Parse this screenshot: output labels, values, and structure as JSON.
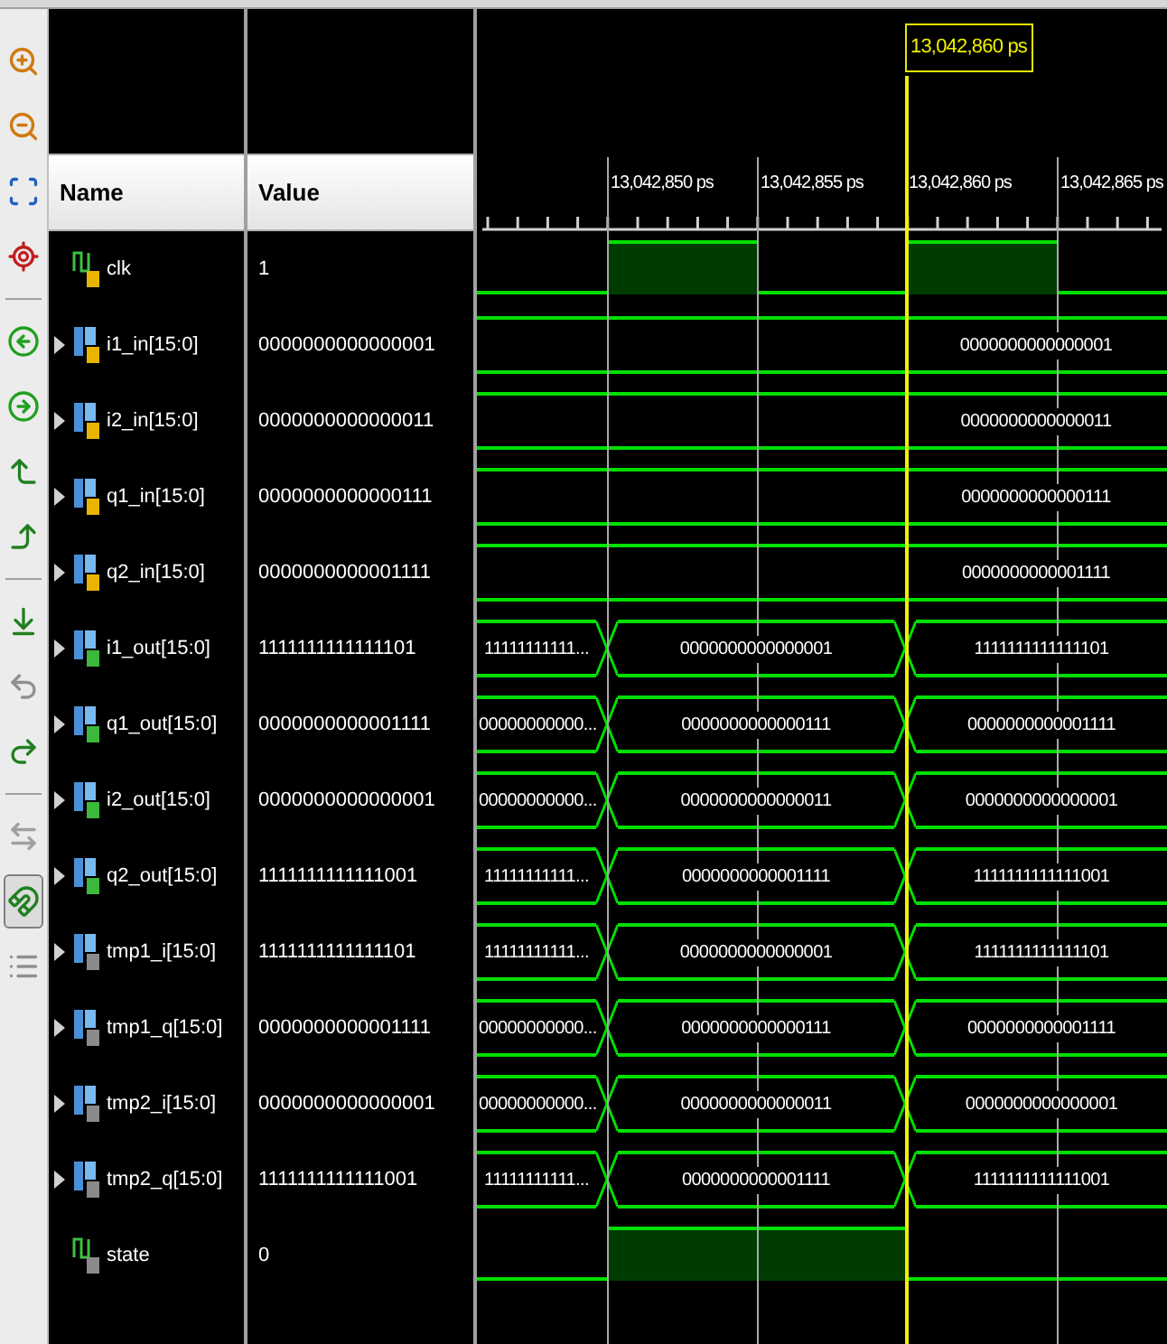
{
  "toolbar": [
    {
      "kind": "zoom-in",
      "selected": false
    },
    {
      "kind": "zoom-out",
      "selected": false
    },
    {
      "kind": "zoom-fit",
      "selected": false
    },
    {
      "kind": "zoom-cursor",
      "selected": false
    },
    {
      "kind": "separator"
    },
    {
      "kind": "go-start",
      "selected": false
    },
    {
      "kind": "go-end",
      "selected": false
    },
    {
      "kind": "prev-transition",
      "selected": false
    },
    {
      "kind": "next-transition",
      "selected": false
    },
    {
      "kind": "separator"
    },
    {
      "kind": "add-marker",
      "selected": false
    },
    {
      "kind": "prev-marker",
      "selected": false
    },
    {
      "kind": "next-marker",
      "selected": false
    },
    {
      "kind": "separator"
    },
    {
      "kind": "swap-cursors",
      "selected": false
    },
    {
      "kind": "snap-cursor",
      "selected": true
    },
    {
      "kind": "list-view",
      "selected": false
    }
  ],
  "columns": [
    "Name",
    "Value"
  ],
  "timeline": {
    "cursor": "13,042,860 ps",
    "ticks": [
      "13,042,850 ps",
      "13,042,855 ps",
      "13,042,860 ps",
      "13,042,865 ps"
    ]
  },
  "rows": [
    {
      "name": "clk",
      "kind": "bit",
      "color": "#e8b400",
      "expandable": false,
      "value": "1",
      "wave": [
        {
          "high": false
        },
        {
          "high": true
        },
        {
          "high": false
        },
        {
          "high": true
        },
        {
          "high": false
        }
      ]
    },
    {
      "name": "i1_in[15:0]",
      "kind": "bus",
      "color": "#e8b400",
      "expandable": true,
      "value": "0000000000000001",
      "wave": [
        {
          "change": false
        },
        {
          "change": false
        },
        {
          "change": false
        },
        {
          "change": false,
          "label": "0000000000000001"
        },
        {
          "change": false
        }
      ]
    },
    {
      "name": "i2_in[15:0]",
      "kind": "bus",
      "color": "#e8b400",
      "expandable": true,
      "value": "0000000000000011",
      "wave": [
        {
          "change": false
        },
        {
          "change": false
        },
        {
          "change": false
        },
        {
          "change": false,
          "label": "0000000000000011"
        },
        {
          "change": false
        }
      ]
    },
    {
      "name": "q1_in[15:0]",
      "kind": "bus",
      "color": "#e8b400",
      "expandable": true,
      "value": "0000000000000111",
      "wave": [
        {
          "change": false
        },
        {
          "change": false
        },
        {
          "change": false
        },
        {
          "change": false,
          "label": "0000000000000111"
        },
        {
          "change": false
        }
      ]
    },
    {
      "name": "q2_in[15:0]",
      "kind": "bus",
      "color": "#e8b400",
      "expandable": true,
      "value": "0000000000001111",
      "wave": [
        {
          "change": false
        },
        {
          "change": false
        },
        {
          "change": false
        },
        {
          "change": false,
          "label": "0000000000001111"
        },
        {
          "change": false
        }
      ]
    },
    {
      "name": "i1_out[15:0]",
      "kind": "bus",
      "color": "#3cb83c",
      "expandable": true,
      "value": "1111111111111101",
      "wave": [
        {
          "change": false,
          "label": "11111111111..."
        },
        {
          "change": true,
          "label": "0000000000000001"
        },
        {
          "change": false
        },
        {
          "change": true,
          "label": "1111111111111101"
        },
        {
          "change": false
        }
      ]
    },
    {
      "name": "q1_out[15:0]",
      "kind": "bus",
      "color": "#3cb83c",
      "expandable": true,
      "value": "0000000000001111",
      "wave": [
        {
          "change": false,
          "label": "00000000000..."
        },
        {
          "change": true,
          "label": "0000000000000111"
        },
        {
          "change": false
        },
        {
          "change": true,
          "label": "0000000000001111"
        },
        {
          "change": false
        }
      ]
    },
    {
      "name": "i2_out[15:0]",
      "kind": "bus",
      "color": "#3cb83c",
      "expandable": true,
      "value": "0000000000000001",
      "wave": [
        {
          "change": false,
          "label": "00000000000..."
        },
        {
          "change": true,
          "label": "0000000000000011"
        },
        {
          "change": false
        },
        {
          "change": true,
          "label": "0000000000000001"
        },
        {
          "change": false
        }
      ]
    },
    {
      "name": "q2_out[15:0]",
      "kind": "bus",
      "color": "#3cb83c",
      "expandable": true,
      "value": "1111111111111001",
      "wave": [
        {
          "change": false,
          "label": "11111111111..."
        },
        {
          "change": true,
          "label": "0000000000001111"
        },
        {
          "change": false
        },
        {
          "change": true,
          "label": "1111111111111001"
        },
        {
          "change": false
        }
      ]
    },
    {
      "name": "tmp1_i[15:0]",
      "kind": "bus",
      "color": "#8a8a8a",
      "expandable": true,
      "value": "1111111111111101",
      "wave": [
        {
          "change": false,
          "label": "11111111111..."
        },
        {
          "change": true,
          "label": "0000000000000001"
        },
        {
          "change": false
        },
        {
          "change": true,
          "label": "1111111111111101"
        },
        {
          "change": false
        }
      ]
    },
    {
      "name": "tmp1_q[15:0]",
      "kind": "bus",
      "color": "#8a8a8a",
      "expandable": true,
      "value": "0000000000001111",
      "wave": [
        {
          "change": false,
          "label": "00000000000..."
        },
        {
          "change": true,
          "label": "0000000000000111"
        },
        {
          "change": false
        },
        {
          "change": true,
          "label": "0000000000001111"
        },
        {
          "change": false
        }
      ]
    },
    {
      "name": "tmp2_i[15:0]",
      "kind": "bus",
      "color": "#8a8a8a",
      "expandable": true,
      "value": "0000000000000001",
      "wave": [
        {
          "change": false,
          "label": "00000000000..."
        },
        {
          "change": true,
          "label": "0000000000000011"
        },
        {
          "change": false
        },
        {
          "change": true,
          "label": "0000000000000001"
        },
        {
          "change": false
        }
      ]
    },
    {
      "name": "tmp2_q[15:0]",
      "kind": "bus",
      "color": "#8a8a8a",
      "expandable": true,
      "value": "1111111111111001",
      "wave": [
        {
          "change": false,
          "label": "11111111111..."
        },
        {
          "change": true,
          "label": "0000000000001111"
        },
        {
          "change": false
        },
        {
          "change": true,
          "label": "1111111111111001"
        },
        {
          "change": false
        }
      ]
    },
    {
      "name": "state",
      "kind": "bit",
      "color": "#8a8a8a",
      "expandable": false,
      "value": "0",
      "wave": [
        {
          "high": false
        },
        {
          "high": true
        },
        {
          "high": true
        },
        {
          "high": false
        },
        {
          "high": false
        }
      ]
    }
  ]
}
